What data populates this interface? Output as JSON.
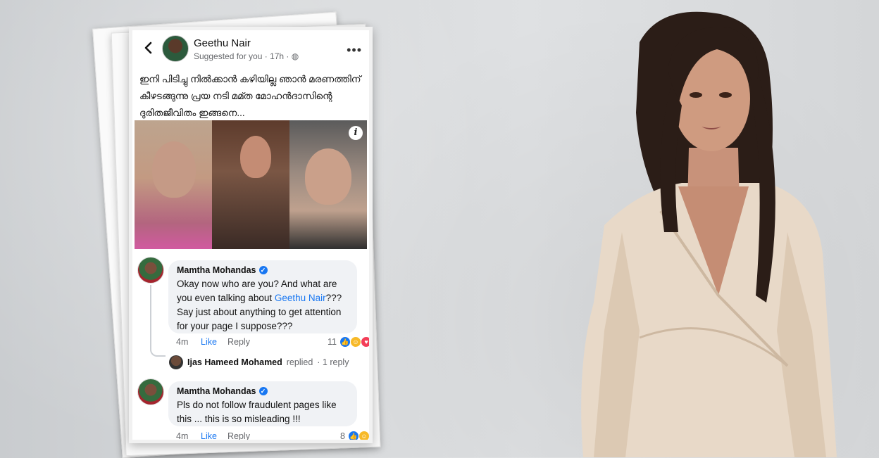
{
  "post": {
    "page_name": "Geethu Nair",
    "subtitle": "Suggested for you · 17h ·",
    "text_line1": "ഇനി പിടിച്ചു നിൽക്കാൻ കഴിയില്ല ഞാൻ മരണത്തിന്",
    "text_line2": "കീഴടങ്ങുന്നു പ്രയ നടി മമ്ത മോഹൻദാസിന്റെ",
    "text_line3": "ദുരിതജീവിതം ഇങ്ങനെ...",
    "info_icon": "i"
  },
  "comments": [
    {
      "name": "Mamtha Mohandas",
      "body_part1": "Okay now who are you? And what are you even talking about ",
      "mention": "Geethu Nair",
      "body_part2": "??? Say just about anything to get attention for your page I suppose???",
      "time": "4m",
      "like": "Like",
      "reply": "Reply",
      "reactions": "11"
    },
    {
      "name": "Mamtha Mohandas",
      "body": "Pls do not follow fraudulent pages like this ... this is so misleading !!!",
      "time": "4m",
      "like": "Like",
      "reply": "Reply",
      "reactions": "8"
    }
  ],
  "reply_thread": {
    "name": "Ijas Hameed Mohamed",
    "replied": "replied",
    "count": "· 1 reply"
  },
  "icons": {
    "back": "chevron-left",
    "more": "•••",
    "verified": "✓",
    "like_reaction": "👍",
    "haha_reaction": "😆",
    "love_reaction": "♥"
  },
  "colors": {
    "facebook_blue": "#1877f2",
    "bubble_gray": "#f0f2f5",
    "meta_gray": "#65676b"
  }
}
